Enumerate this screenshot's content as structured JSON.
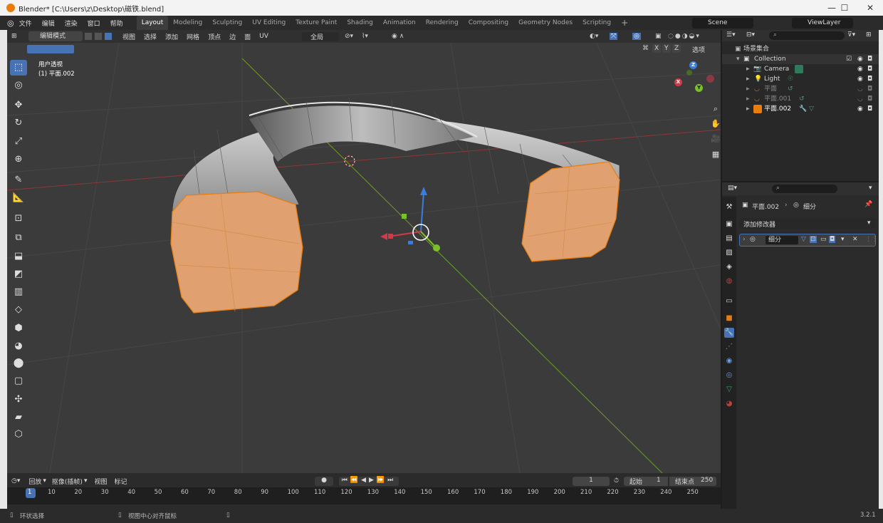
{
  "window": {
    "title": "Blender* [C:\\Users\\z\\Desktop\\磁铁.blend]",
    "minimize": "—",
    "maximize": "☐",
    "close": "✕"
  },
  "menu": [
    "文件",
    "编辑",
    "渲染",
    "窗口",
    "帮助"
  ],
  "workspaces": [
    "Layout",
    "Modeling",
    "Sculpting",
    "UV Editing",
    "Texture Paint",
    "Shading",
    "Animation",
    "Rendering",
    "Compositing",
    "Geometry Nodes",
    "Scripting"
  ],
  "active_workspace": "Layout",
  "scene": {
    "label": "Scene"
  },
  "view_layer": {
    "label": "ViewLayer"
  },
  "viewport": {
    "mode": "编辑模式",
    "menus": [
      "视图",
      "选择",
      "添加",
      "网格",
      "顶点",
      "边",
      "面",
      "UV"
    ],
    "transform_orientation": "全局",
    "overlay_title": "用户透视",
    "overlay_object": "(1) 平面.002",
    "xyz": [
      "X",
      "Y",
      "Z"
    ],
    "options": "选项"
  },
  "gizmo": {
    "x": "X",
    "y": "Y",
    "z": "Z"
  },
  "outliner": {
    "root": "场景集合",
    "collection": "Collection",
    "items": [
      {
        "name": "Camera"
      },
      {
        "name": "Light"
      },
      {
        "name": "平面"
      },
      {
        "name": "平面.001"
      },
      {
        "name": "平面.002"
      }
    ]
  },
  "properties": {
    "breadcrumb_object": "平面.002",
    "breadcrumb_modifier": "细分",
    "add_modifier": "添加修改器",
    "modifier_name": "细分"
  },
  "timeline": {
    "menus": [
      "回放",
      "抠像(插帧)",
      "视图",
      "标记"
    ],
    "current_frame": "1",
    "start_label": "起始",
    "start": "1",
    "end_label": "结束点",
    "end": "250",
    "ticks": [
      "1",
      "10",
      "20",
      "30",
      "40",
      "50",
      "60",
      "70",
      "80",
      "90",
      "100",
      "110",
      "120",
      "130",
      "140",
      "150",
      "160",
      "170",
      "180",
      "190",
      "200",
      "210",
      "220",
      "230",
      "240",
      "250"
    ]
  },
  "status": {
    "left": "环状选择",
    "middle": "视图中心对齐鼠标",
    "version": "3.2.1"
  },
  "colors": {
    "accent": "#4772b3",
    "selected_face": "#e0a070",
    "grid": "#3b3b3b"
  }
}
